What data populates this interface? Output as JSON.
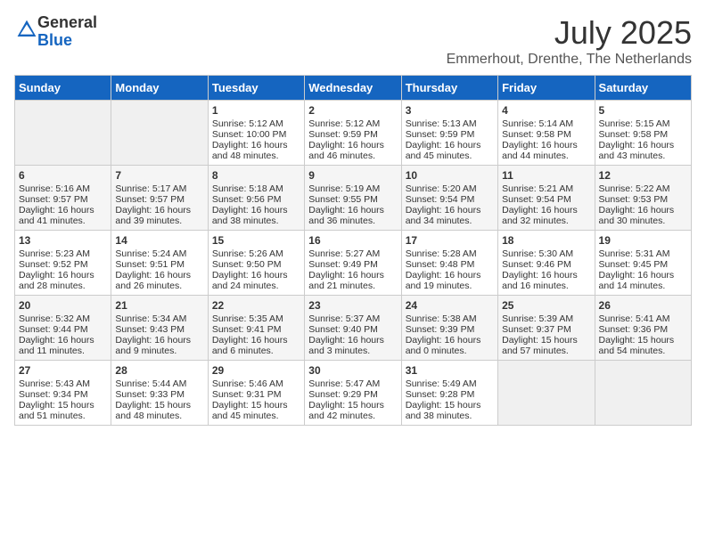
{
  "logo": {
    "general": "General",
    "blue": "Blue"
  },
  "header": {
    "month": "July 2025",
    "location": "Emmerhout, Drenthe, The Netherlands"
  },
  "weekdays": [
    "Sunday",
    "Monday",
    "Tuesday",
    "Wednesday",
    "Thursday",
    "Friday",
    "Saturday"
  ],
  "weeks": [
    [
      {
        "day": "",
        "empty": true
      },
      {
        "day": "",
        "empty": true
      },
      {
        "day": "1",
        "sunrise": "Sunrise: 5:12 AM",
        "sunset": "Sunset: 10:00 PM",
        "daylight": "Daylight: 16 hours and 48 minutes."
      },
      {
        "day": "2",
        "sunrise": "Sunrise: 5:12 AM",
        "sunset": "Sunset: 9:59 PM",
        "daylight": "Daylight: 16 hours and 46 minutes."
      },
      {
        "day": "3",
        "sunrise": "Sunrise: 5:13 AM",
        "sunset": "Sunset: 9:59 PM",
        "daylight": "Daylight: 16 hours and 45 minutes."
      },
      {
        "day": "4",
        "sunrise": "Sunrise: 5:14 AM",
        "sunset": "Sunset: 9:58 PM",
        "daylight": "Daylight: 16 hours and 44 minutes."
      },
      {
        "day": "5",
        "sunrise": "Sunrise: 5:15 AM",
        "sunset": "Sunset: 9:58 PM",
        "daylight": "Daylight: 16 hours and 43 minutes."
      }
    ],
    [
      {
        "day": "6",
        "sunrise": "Sunrise: 5:16 AM",
        "sunset": "Sunset: 9:57 PM",
        "daylight": "Daylight: 16 hours and 41 minutes."
      },
      {
        "day": "7",
        "sunrise": "Sunrise: 5:17 AM",
        "sunset": "Sunset: 9:57 PM",
        "daylight": "Daylight: 16 hours and 39 minutes."
      },
      {
        "day": "8",
        "sunrise": "Sunrise: 5:18 AM",
        "sunset": "Sunset: 9:56 PM",
        "daylight": "Daylight: 16 hours and 38 minutes."
      },
      {
        "day": "9",
        "sunrise": "Sunrise: 5:19 AM",
        "sunset": "Sunset: 9:55 PM",
        "daylight": "Daylight: 16 hours and 36 minutes."
      },
      {
        "day": "10",
        "sunrise": "Sunrise: 5:20 AM",
        "sunset": "Sunset: 9:54 PM",
        "daylight": "Daylight: 16 hours and 34 minutes."
      },
      {
        "day": "11",
        "sunrise": "Sunrise: 5:21 AM",
        "sunset": "Sunset: 9:54 PM",
        "daylight": "Daylight: 16 hours and 32 minutes."
      },
      {
        "day": "12",
        "sunrise": "Sunrise: 5:22 AM",
        "sunset": "Sunset: 9:53 PM",
        "daylight": "Daylight: 16 hours and 30 minutes."
      }
    ],
    [
      {
        "day": "13",
        "sunrise": "Sunrise: 5:23 AM",
        "sunset": "Sunset: 9:52 PM",
        "daylight": "Daylight: 16 hours and 28 minutes."
      },
      {
        "day": "14",
        "sunrise": "Sunrise: 5:24 AM",
        "sunset": "Sunset: 9:51 PM",
        "daylight": "Daylight: 16 hours and 26 minutes."
      },
      {
        "day": "15",
        "sunrise": "Sunrise: 5:26 AM",
        "sunset": "Sunset: 9:50 PM",
        "daylight": "Daylight: 16 hours and 24 minutes."
      },
      {
        "day": "16",
        "sunrise": "Sunrise: 5:27 AM",
        "sunset": "Sunset: 9:49 PM",
        "daylight": "Daylight: 16 hours and 21 minutes."
      },
      {
        "day": "17",
        "sunrise": "Sunrise: 5:28 AM",
        "sunset": "Sunset: 9:48 PM",
        "daylight": "Daylight: 16 hours and 19 minutes."
      },
      {
        "day": "18",
        "sunrise": "Sunrise: 5:30 AM",
        "sunset": "Sunset: 9:46 PM",
        "daylight": "Daylight: 16 hours and 16 minutes."
      },
      {
        "day": "19",
        "sunrise": "Sunrise: 5:31 AM",
        "sunset": "Sunset: 9:45 PM",
        "daylight": "Daylight: 16 hours and 14 minutes."
      }
    ],
    [
      {
        "day": "20",
        "sunrise": "Sunrise: 5:32 AM",
        "sunset": "Sunset: 9:44 PM",
        "daylight": "Daylight: 16 hours and 11 minutes."
      },
      {
        "day": "21",
        "sunrise": "Sunrise: 5:34 AM",
        "sunset": "Sunset: 9:43 PM",
        "daylight": "Daylight: 16 hours and 9 minutes."
      },
      {
        "day": "22",
        "sunrise": "Sunrise: 5:35 AM",
        "sunset": "Sunset: 9:41 PM",
        "daylight": "Daylight: 16 hours and 6 minutes."
      },
      {
        "day": "23",
        "sunrise": "Sunrise: 5:37 AM",
        "sunset": "Sunset: 9:40 PM",
        "daylight": "Daylight: 16 hours and 3 minutes."
      },
      {
        "day": "24",
        "sunrise": "Sunrise: 5:38 AM",
        "sunset": "Sunset: 9:39 PM",
        "daylight": "Daylight: 16 hours and 0 minutes."
      },
      {
        "day": "25",
        "sunrise": "Sunrise: 5:39 AM",
        "sunset": "Sunset: 9:37 PM",
        "daylight": "Daylight: 15 hours and 57 minutes."
      },
      {
        "day": "26",
        "sunrise": "Sunrise: 5:41 AM",
        "sunset": "Sunset: 9:36 PM",
        "daylight": "Daylight: 15 hours and 54 minutes."
      }
    ],
    [
      {
        "day": "27",
        "sunrise": "Sunrise: 5:43 AM",
        "sunset": "Sunset: 9:34 PM",
        "daylight": "Daylight: 15 hours and 51 minutes."
      },
      {
        "day": "28",
        "sunrise": "Sunrise: 5:44 AM",
        "sunset": "Sunset: 9:33 PM",
        "daylight": "Daylight: 15 hours and 48 minutes."
      },
      {
        "day": "29",
        "sunrise": "Sunrise: 5:46 AM",
        "sunset": "Sunset: 9:31 PM",
        "daylight": "Daylight: 15 hours and 45 minutes."
      },
      {
        "day": "30",
        "sunrise": "Sunrise: 5:47 AM",
        "sunset": "Sunset: 9:29 PM",
        "daylight": "Daylight: 15 hours and 42 minutes."
      },
      {
        "day": "31",
        "sunrise": "Sunrise: 5:49 AM",
        "sunset": "Sunset: 9:28 PM",
        "daylight": "Daylight: 15 hours and 38 minutes."
      },
      {
        "day": "",
        "empty": true
      },
      {
        "day": "",
        "empty": true
      }
    ]
  ]
}
